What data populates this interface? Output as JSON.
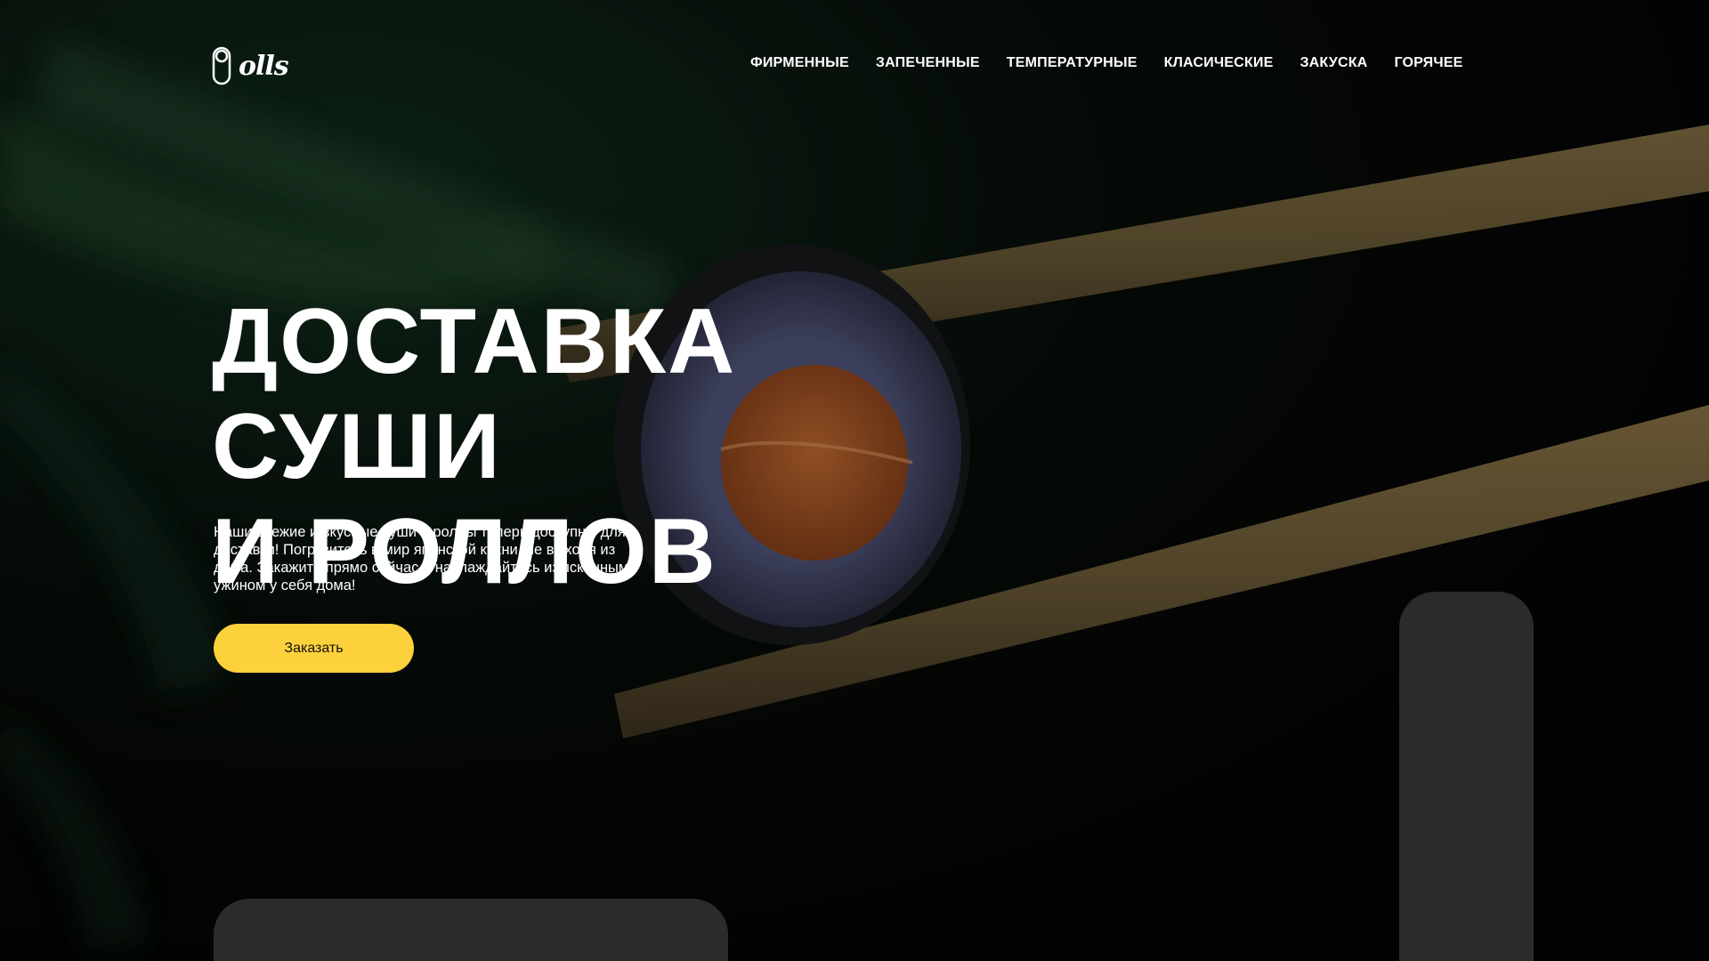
{
  "brand": {
    "logo_text": "olls",
    "logo_icon": "roll-icon"
  },
  "nav": {
    "items": [
      {
        "label": "ФИРМЕННЫЕ"
      },
      {
        "label": "ЗАПЕЧЕННЫЕ"
      },
      {
        "label": "ТЕМПЕРАТУРНЫЕ"
      },
      {
        "label": "КЛАСИЧЕСКИЕ"
      },
      {
        "label": "ЗАКУСКА"
      },
      {
        "label": "ГОРЯЧЕЕ"
      }
    ]
  },
  "hero": {
    "title_line1": "ДОСТАВКА СУШИ",
    "title_line2": "И РОЛЛОВ",
    "description": "Наши свежие и вкусные суши и роллы теперь доступны для доставки! Погрузитесь в мир японской кухни, не выходя из дома. Закажите прямо сейчас и наслаждайтесь изысканным ужином у себя дома!",
    "cta_label": "Заказать"
  },
  "colors": {
    "accent": "#fdd13b",
    "panel": "#2b2b2b",
    "text": "#ffffff"
  }
}
